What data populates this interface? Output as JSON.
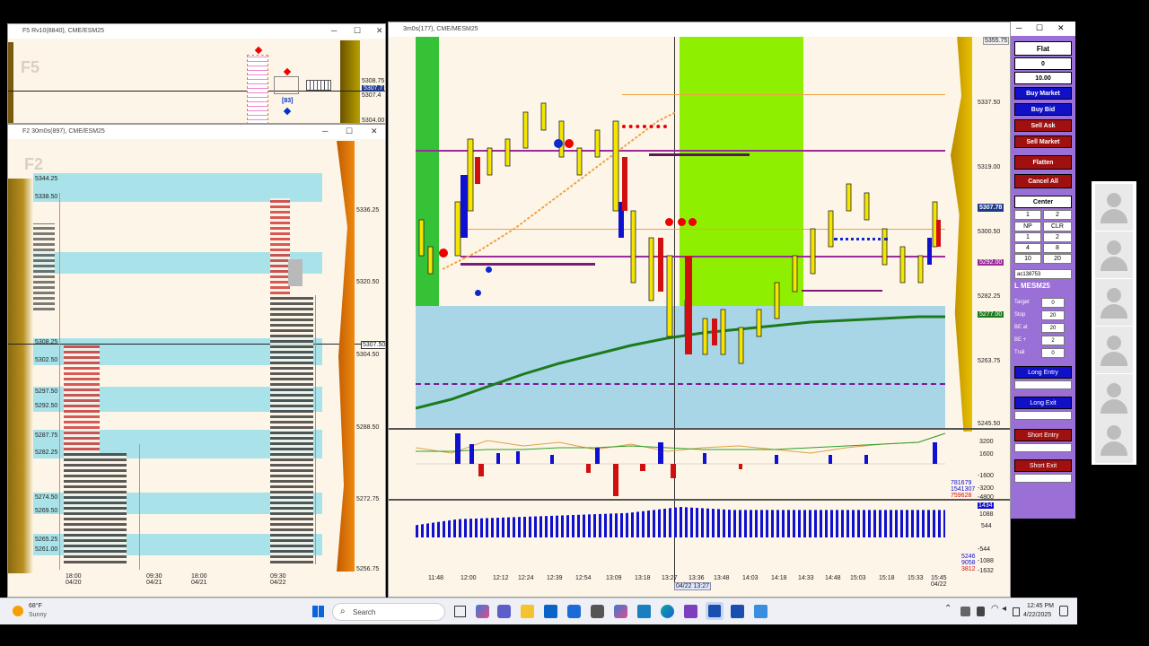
{
  "win_f5": {
    "title": "F5 Rv10(8840), CME/ESM25",
    "watermark": "F5",
    "prices": [
      "5308.75",
      "5307.7",
      "5307.4",
      "5304.00"
    ],
    "label_83": "[83]"
  },
  "win_f2": {
    "title": "F2 30m0s(897), CME/ESM25",
    "watermark": "F2",
    "prices": [
      "5336.25",
      "5320.50",
      "5304.50",
      "5288.50",
      "5272.75",
      "5256.75"
    ],
    "cursor_price": "5307.50",
    "left_prices": [
      "5344.25",
      "5338.50",
      "5308.25",
      "5302.50",
      "5297.50",
      "5292.50",
      "5287.75",
      "5282.25",
      "5274.50",
      "5269.50",
      "5265.25",
      "5261.00"
    ],
    "dates": [
      {
        "time": "18:00",
        "date": "04/20"
      },
      {
        "time": "09:30",
        "date": "04/21"
      },
      {
        "time": "18:00",
        "date": "04/21"
      },
      {
        "time": "09:30",
        "date": "04/22"
      }
    ]
  },
  "win_main": {
    "title": "3m0s(177), CME/MESM25",
    "prices": [
      "5355.75",
      "5337.50",
      "5319.00",
      "5307.78",
      "5300.50",
      "5292.00",
      "5282.25",
      "5277.00",
      "5263.75",
      "5245.50"
    ],
    "osc1_labels": [
      "3200",
      "1600",
      "-1600",
      "-3200",
      "-4800"
    ],
    "osc1_values": [
      "781679",
      "1541307",
      "759628"
    ],
    "osc2_labels": [
      "1434",
      "1088",
      "544",
      "-544",
      "-1088",
      "-1632"
    ],
    "osc2_values": [
      "5246",
      "9058",
      "3812"
    ],
    "times": [
      "11:48",
      "12:00",
      "12:12",
      "12:24",
      "12:39",
      "12:54",
      "13:09",
      "13:18",
      "13:27",
      "13:36",
      "13:48",
      "14:03",
      "14:18",
      "14:33",
      "14:48",
      "15:03",
      "15:18",
      "15:33",
      "15:45"
    ],
    "cursor_time": "04/22 13:27",
    "end_date": "04/22"
  },
  "order_panel": {
    "position": "Flat",
    "qty": "0",
    "price": "10.00",
    "buy_market": "Buy Market",
    "buy_bid": "Buy Bid",
    "sell_ask": "Sell Ask",
    "sell_market": "Sell Market",
    "flatten": "Flatten",
    "cancel_all": "Cancel All",
    "center": "Center",
    "qty_presets": [
      [
        "1",
        "2"
      ],
      [
        "NP",
        "CLR"
      ],
      [
        "1",
        "2"
      ],
      [
        "4",
        "8"
      ],
      [
        "10",
        "20"
      ]
    ],
    "account": "ac138753",
    "symbol": "L MESM25",
    "fields": [
      {
        "label": "Target",
        "value": "0"
      },
      {
        "label": "Stop",
        "value": "20"
      },
      {
        "label": "BE at",
        "value": "20"
      },
      {
        "label": "BE +",
        "value": "2"
      },
      {
        "label": "Trail",
        "value": "0"
      }
    ],
    "long_entry": "Long Entry",
    "long_exit": "Long Exit",
    "short_entry": "Short Entry",
    "short_exit": "Short Exit"
  },
  "taskbar": {
    "weather_temp": "68°F",
    "weather_desc": "Sunny",
    "search_placeholder": "Search",
    "time": "12:45 PM",
    "date": "4/22/2025"
  },
  "colors": {
    "buy": "#1010d0",
    "sell": "#a01010",
    "panel_bg": "#9a6fd6",
    "value_area": "#a9d6e6",
    "session_green": "#8ef000"
  }
}
